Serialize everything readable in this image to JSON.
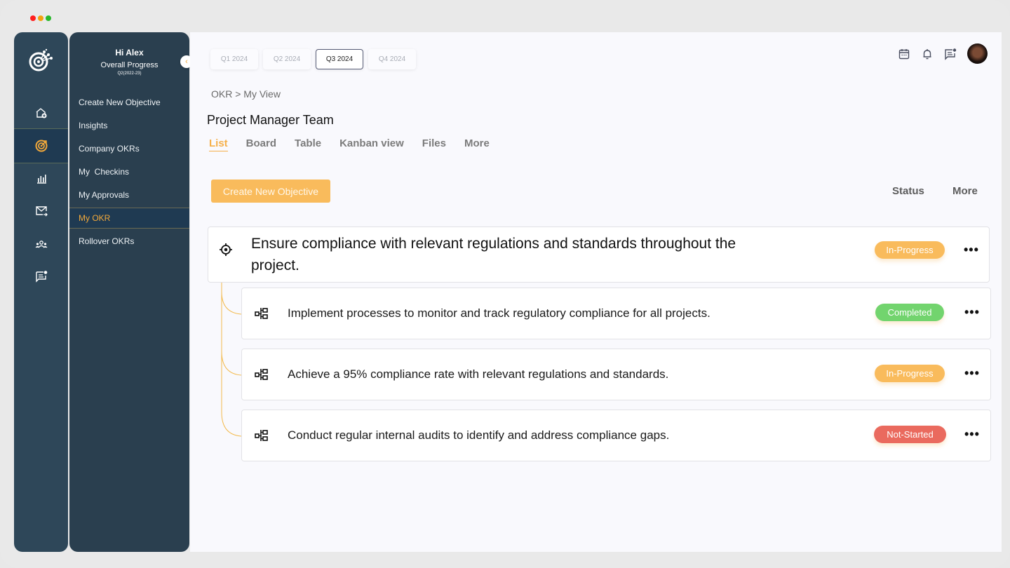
{
  "window": {
    "traffic_lights": [
      "#ff1f1f",
      "#f2a20f",
      "#29b82c"
    ]
  },
  "rail": {
    "logo_icon": "target-network-logo",
    "items": [
      {
        "name": "home",
        "icon": "home-plus-icon",
        "active": false
      },
      {
        "name": "okr",
        "icon": "target-icon",
        "active": true
      },
      {
        "name": "reports",
        "icon": "bar-chart-icon",
        "active": false
      },
      {
        "name": "mail",
        "icon": "mail-forward-icon",
        "active": false
      },
      {
        "name": "team",
        "icon": "team-icon",
        "active": false
      },
      {
        "name": "messages",
        "icon": "chat-notification-icon",
        "active": false
      }
    ]
  },
  "menu": {
    "greeting": "Hi Alex",
    "progress_label": "Overall Progress",
    "period": "Q2(2022-23)",
    "items": [
      {
        "label": "Create New Objective",
        "active": false
      },
      {
        "label": "Insights",
        "active": false
      },
      {
        "label": "Company OKRs",
        "active": false
      },
      {
        "label": "My  Checkins",
        "active": false
      },
      {
        "label": "My Approvals",
        "active": false
      },
      {
        "label": "My OKR",
        "active": true
      },
      {
        "label": "Rollover OKRs",
        "active": false
      }
    ],
    "collapse_icon": "chevron-left-icon"
  },
  "header": {
    "quarters": [
      {
        "label": "Q1 2024",
        "active": false
      },
      {
        "label": "Q2 2024",
        "active": false
      },
      {
        "label": "Q3 2024",
        "active": true
      },
      {
        "label": "Q4 2024",
        "active": false
      }
    ],
    "icons": [
      "calendar-icon",
      "bell-icon",
      "chat-notification-icon"
    ],
    "avatar": "user-avatar"
  },
  "breadcrumb": "OKR > My View",
  "page_title": "Project Manager Team",
  "view_tabs": [
    {
      "label": "List",
      "active": true
    },
    {
      "label": "Board",
      "active": false
    },
    {
      "label": "Table",
      "active": false
    },
    {
      "label": "Kanban view",
      "active": false
    },
    {
      "label": "Files",
      "active": false
    },
    {
      "label": "More",
      "active": false
    }
  ],
  "toolbar": {
    "create_label": "Create New Objective",
    "status_label": "Status",
    "more_label": "More"
  },
  "objective": {
    "title": "Ensure compliance with relevant regulations and standards throughout the project.",
    "status": "In-Progress",
    "status_color": "#f9bb5c",
    "more": "•••"
  },
  "key_results": [
    {
      "title": "Implement processes to monitor and track regulatory compliance for all projects.",
      "status": "Completed",
      "status_color": "#72d46e",
      "more": "•••"
    },
    {
      "title": "Achieve a 95% compliance rate with relevant regulations and standards.",
      "status": "In-Progress",
      "status_color": "#f9bb5c",
      "more": "•••"
    },
    {
      "title": "Conduct regular internal audits to identify and address compliance gaps.",
      "status": "Not-Started",
      "status_color": "#ea6a5e",
      "more": "•••"
    }
  ],
  "colors": {
    "accent": "#f5b04a",
    "rail_bg": "#2e4759",
    "menu_bg": "#2a3f4f",
    "tree_line": "#f3b94a"
  }
}
